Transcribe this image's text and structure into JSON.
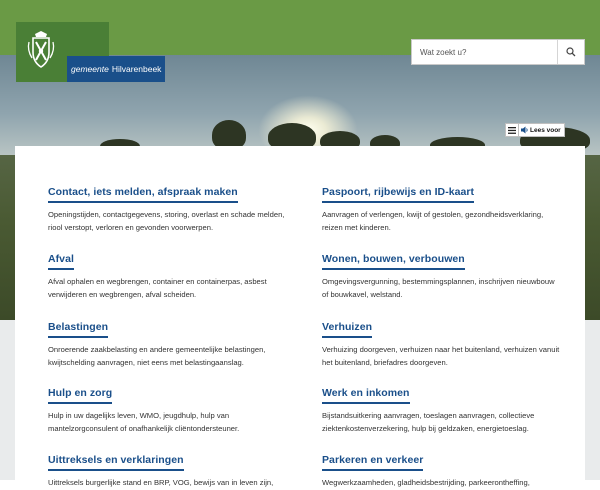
{
  "brand": {
    "prefix": "gemeente",
    "name": "Hilvarenbeek",
    "crest_icon": "municipal-crest-icon"
  },
  "search": {
    "placeholder": "Wat zoekt u?",
    "icon": "search-icon"
  },
  "readspeaker": {
    "label": "Lees voor"
  },
  "colors": {
    "green": "#6a9a45",
    "logo_green": "#4a7f36",
    "blue": "#1a4f8a"
  },
  "tiles": [
    {
      "title": "Contact, iets melden, afspraak maken",
      "desc": "Openingstijden, contactgegevens, storing, overlast en schade melden, riool verstopt, verloren en gevonden voorwerpen."
    },
    {
      "title": "Paspoort, rijbewijs en ID-kaart",
      "desc": "Aanvragen of verlengen, kwijt of gestolen, gezondheidsverklaring, reizen met kinderen."
    },
    {
      "title": "Afval",
      "desc": "Afval ophalen en wegbrengen, container en containerpas, asbest verwijderen en wegbrengen, afval scheiden."
    },
    {
      "title": "Wonen, bouwen, verbouwen",
      "desc": "Omgevingsvergunning, bestemmingsplannen, inschrijven nieuwbouw of bouwkavel, welstand."
    },
    {
      "title": "Belastingen",
      "desc": "Onroerende zaakbelasting en andere gemeentelijke belastingen, kwijtschelding aanvragen, niet eens met belastingaanslag."
    },
    {
      "title": "Verhuizen",
      "desc": "Verhuizing doorgeven, verhuizen naar het buitenland, verhuizen vanuit het buitenland, briefadres doorgeven."
    },
    {
      "title": "Hulp en zorg",
      "desc": "Hulp in uw dagelijks leven, WMO, jeugdhulp, hulp van mantelzorgconsulent of onafhankelijk cliëntondersteuner."
    },
    {
      "title": "Werk en inkomen",
      "desc": "Bijstandsuitkering aanvragen, toeslagen aanvragen, collectieve ziektenkostenverzekering, hulp bij geldzaken, energietoeslag."
    },
    {
      "title": "Uittreksels en verklaringen",
      "desc": "Uittreksels burgerlijke stand en BRP, VOG, bewijs van in leven zijn,"
    },
    {
      "title": "Parkeren en verkeer",
      "desc": "Wegwerkzaamheden, gladheidsbestrijding, parkeerontheffing,"
    }
  ]
}
